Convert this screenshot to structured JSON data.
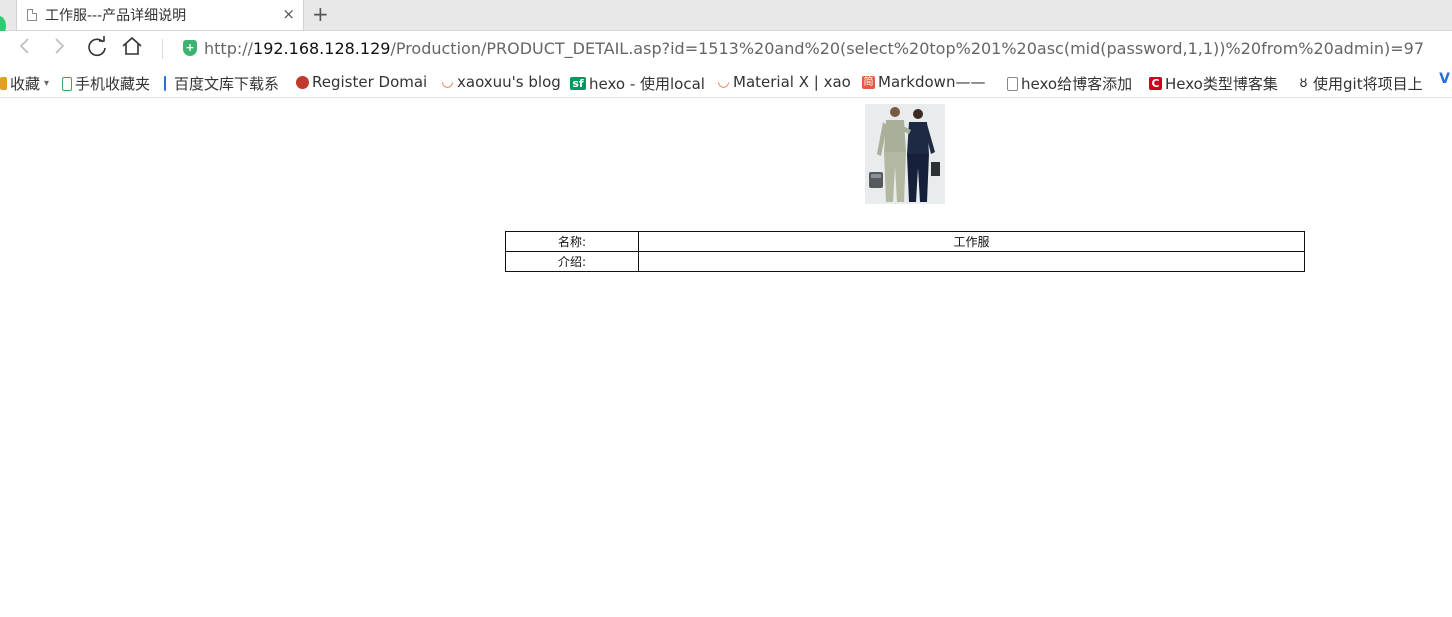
{
  "browser": {
    "tab": {
      "title": "工作服---产品详细说明",
      "close": "×"
    },
    "new_tab": "+",
    "address": {
      "scheme": "http://",
      "host": "192.168.128.129",
      "path": "/Production/PRODUCT_DETAIL.asp?id=1513%20and%20(select%20top%201%20asc(mid(password,1,1))%20from%20admin)=97"
    },
    "bookmarks": [
      {
        "label": "收藏",
        "icon": "favorites-icon",
        "color": "#e0a020"
      },
      {
        "label": "手机收藏夹",
        "icon": "phone-icon",
        "color": "#3aa757"
      },
      {
        "label": "百度文库下载系",
        "icon": "bar-icon",
        "color": "#2a6fd6"
      },
      {
        "label": "Register Domai",
        "icon": "register-icon",
        "color": "#c0392b"
      },
      {
        "label": "xaoxuu's blog",
        "icon": "smile-icon",
        "color": "#e8743b"
      },
      {
        "label": "hexo - 使用local",
        "icon": "sf-icon",
        "color": "#009a61"
      },
      {
        "label": "Material X | xao",
        "icon": "smile-icon",
        "color": "#e8743b"
      },
      {
        "label": "Markdown——",
        "icon": "jian-icon",
        "color": "#e05d44"
      },
      {
        "label": "hexo给博客添加",
        "icon": "page-icon",
        "color": "#888888"
      },
      {
        "label": "Hexo类型博客集",
        "icon": "c-icon",
        "color": "#d0021b"
      },
      {
        "label": "使用git将项目上",
        "icon": "git-icon",
        "color": "#333333"
      }
    ]
  },
  "product": {
    "rows": [
      {
        "label": "名称:",
        "value": "工作服"
      },
      {
        "label": "介绍:",
        "value": ""
      }
    ]
  }
}
